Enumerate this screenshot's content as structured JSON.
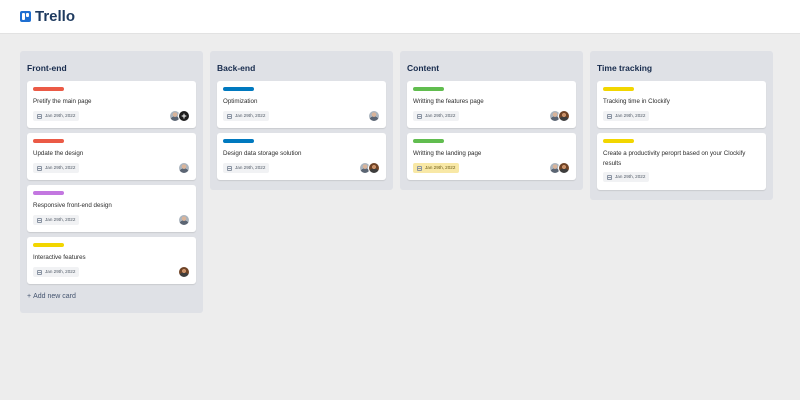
{
  "app": {
    "name": "Trello"
  },
  "colors": {
    "red": "#eb5a46",
    "blue": "#0079bf",
    "green": "#61bd4f",
    "yellow": "#f2d600",
    "purple": "#c377e0"
  },
  "lists": [
    {
      "title": "Front-end",
      "cards": [
        {
          "label_color": "#eb5a46",
          "title": "Pretify the main page",
          "date": "Jan 29th, 2022",
          "avatars": [
            "man-avatar",
            "add-member-icon"
          ]
        },
        {
          "label_color": "#eb5a46",
          "title": "Update the design",
          "date": "Jan 29th, 2022",
          "avatars": [
            "man-avatar"
          ]
        },
        {
          "label_color": "#c377e0",
          "title": "Responsive front-end design",
          "date": "Jan 29th, 2022",
          "avatars": [
            "man-avatar"
          ]
        },
        {
          "label_color": "#f2d600",
          "title": "Interactive features",
          "date": "Jan 29th, 2022",
          "avatars": [
            "woman-avatar"
          ]
        }
      ],
      "add_card": {
        "icon": "+",
        "label": "Add new card"
      }
    },
    {
      "title": "Back-end",
      "cards": [
        {
          "label_color": "#0079bf",
          "title": "Optimization",
          "date": "Jan 29th, 2022",
          "avatars": [
            "man-avatar"
          ]
        },
        {
          "label_color": "#0079bf",
          "title": "Design data storage solution",
          "date": "Jan 29th, 2022",
          "avatars": [
            "man-avatar",
            "woman-avatar"
          ]
        }
      ]
    },
    {
      "title": "Content",
      "cards": [
        {
          "label_color": "#61bd4f",
          "title": "Writting the features page",
          "date": "Jan 29th, 2022",
          "avatars": [
            "man-avatar",
            "woman-avatar"
          ]
        },
        {
          "label_color": "#61bd4f",
          "title": "Writting the landing page",
          "date": "Jan 29th, 2022",
          "date_highlight": true,
          "avatars": [
            "man-avatar",
            "woman-avatar"
          ]
        }
      ]
    },
    {
      "title": "Time tracking",
      "cards": [
        {
          "label_color": "#f2d600",
          "title": "Tracking time in Clockify",
          "date": "Jan 29th, 2022",
          "avatars": []
        },
        {
          "label_color": "#f2d600",
          "title": "Create a productivity peroprt based on your Clockify results",
          "date": "Jan 29th, 2022",
          "avatars": []
        }
      ]
    }
  ]
}
